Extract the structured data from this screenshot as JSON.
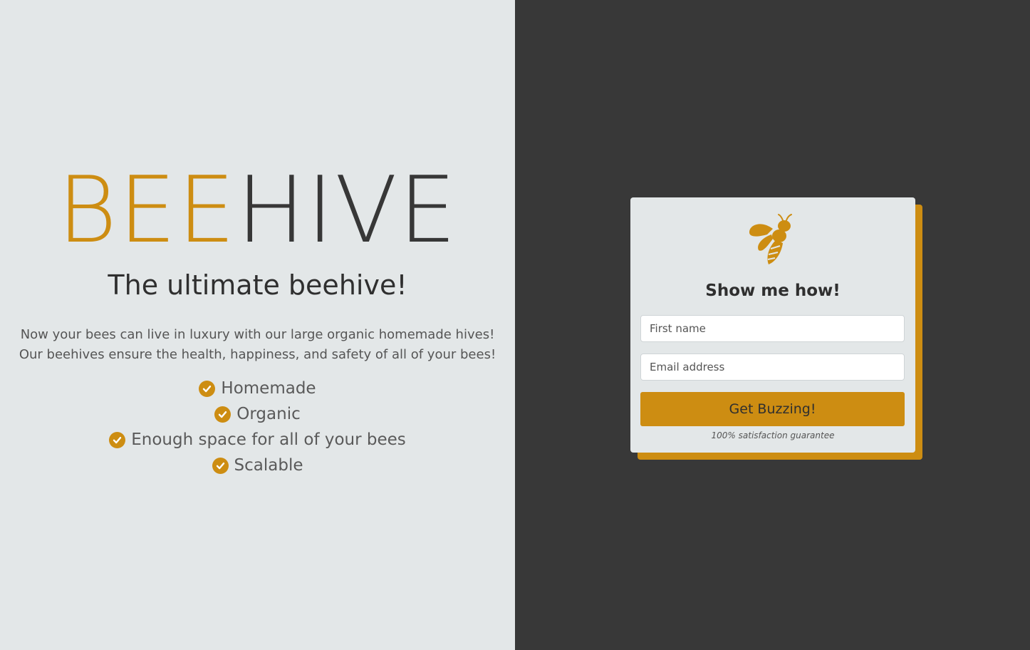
{
  "colors": {
    "accent": "#cd8d12",
    "left_bg": "#e3e7e8",
    "right_bg": "#383838",
    "dark_text": "#373737"
  },
  "hero": {
    "logo_part1": "BEE",
    "logo_part2": "HIVE",
    "tagline": "The ultimate beehive!",
    "description": "Now your bees can live in luxury with our large organic homemade hives! Our beehives ensure the health, happiness, and safety of all of your bees!",
    "features": [
      {
        "icon": "check-circle-icon",
        "label": "Homemade"
      },
      {
        "icon": "check-circle-icon",
        "label": "Organic"
      },
      {
        "icon": "check-circle-icon",
        "label": "Enough space for all of your bees"
      },
      {
        "icon": "check-circle-icon",
        "label": "Scalable"
      }
    ]
  },
  "signup": {
    "icon": "bee-icon",
    "title": "Show me how!",
    "first_name_placeholder": "First name",
    "email_placeholder": "Email address",
    "button_label": "Get Buzzing!",
    "guarantee": "100% satisfaction guarantee"
  }
}
